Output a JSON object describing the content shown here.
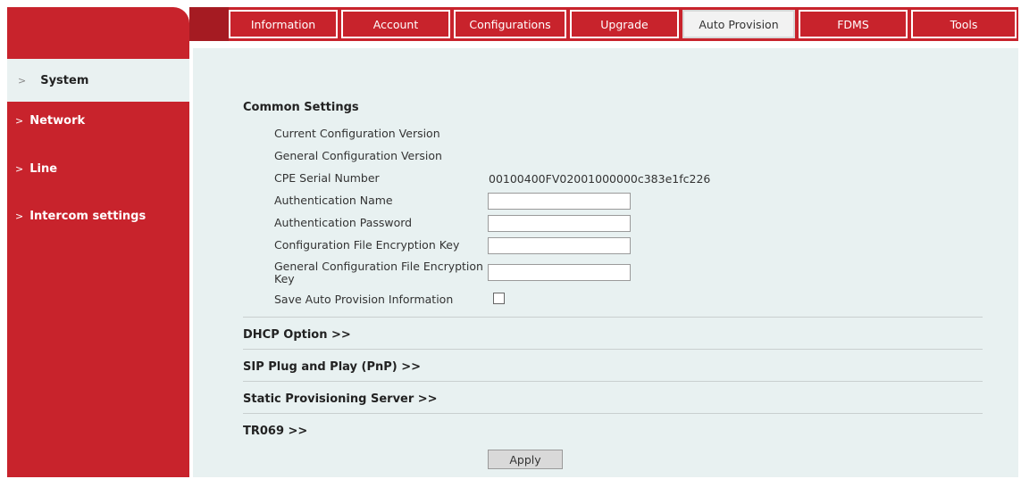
{
  "tabs": [
    {
      "label": "Information"
    },
    {
      "label": "Account"
    },
    {
      "label": "Configurations"
    },
    {
      "label": "Upgrade"
    },
    {
      "label": "Auto Provision"
    },
    {
      "label": "FDMS"
    },
    {
      "label": "Tools"
    }
  ],
  "active_tab": "Auto Provision",
  "sidebar": {
    "items": [
      {
        "label": "System",
        "chevron": ">"
      },
      {
        "label": "Network",
        "chevron": ">"
      },
      {
        "label": "Line",
        "chevron": ">"
      },
      {
        "label": "Intercom settings",
        "chevron": ">"
      }
    ]
  },
  "common_settings": {
    "title": "Common Settings",
    "current_config_version_label": "Current Configuration Version",
    "general_config_version_label": "General Configuration Version",
    "cpe_serial_label": "CPE Serial Number",
    "cpe_serial_value": "00100400FV02001000000c383e1fc226",
    "auth_name_label": "Authentication Name",
    "auth_password_label": "Authentication Password",
    "config_key_label": "Configuration File Encryption Key",
    "general_config_key_label_line1": "General Configuration File Encryption",
    "general_config_key_label_line2": "Key",
    "save_info_label": "Save Auto Provision Information"
  },
  "sections": {
    "dhcp": "DHCP Option >>",
    "pnp": "SIP Plug and Play (PnP) >>",
    "static": "Static Provisioning Server >>",
    "tr069": "TR069 >>"
  },
  "apply_label": "Apply",
  "colors": {
    "brand_red": "#c8232c",
    "content_bg": "#e8f1f1"
  }
}
